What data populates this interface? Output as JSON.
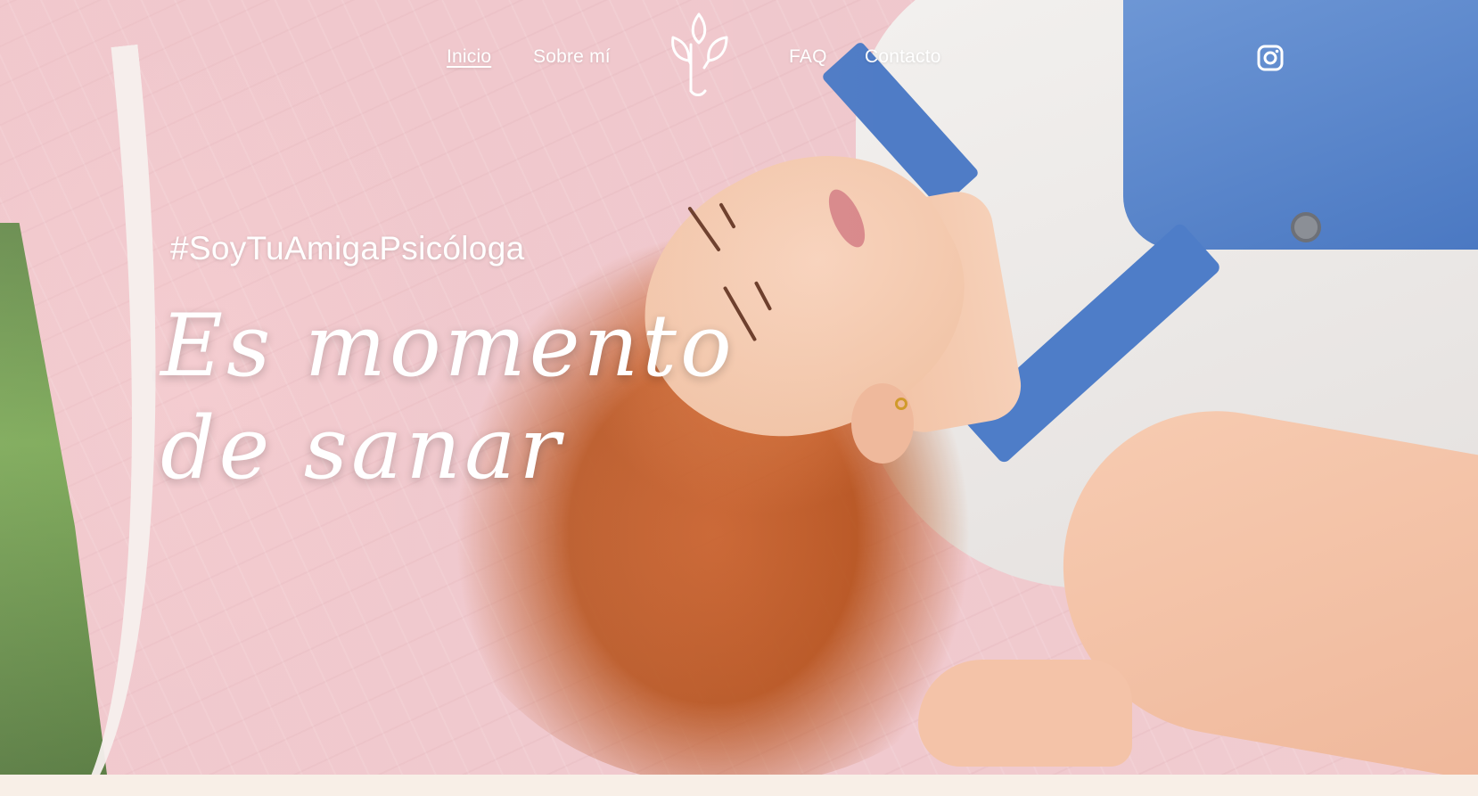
{
  "nav": {
    "items": [
      {
        "label": "Inicio",
        "active": true
      },
      {
        "label": "Sobre mí",
        "active": false
      },
      {
        "label": "FAQ",
        "active": false
      },
      {
        "label": "Contacto",
        "active": false
      }
    ],
    "logo_icon": "plant-sprout-icon",
    "social_icon": "instagram-icon"
  },
  "hero": {
    "hashtag": "#SoyTuAmigaPsicóloga",
    "headline_line1": "Es momento",
    "headline_line2": "de sanar"
  },
  "colors": {
    "text": "#ffffff",
    "background_bottom": "#f8efe7",
    "blanket_pink": "#efc7cc"
  }
}
